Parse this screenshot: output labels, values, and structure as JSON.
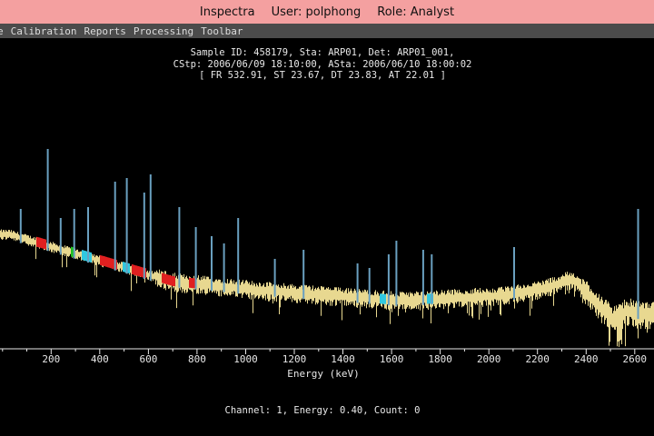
{
  "window": {
    "app_name": "Inspectra",
    "user": "User: polphong",
    "role": "Role: Analyst"
  },
  "menu": {
    "items": [
      "e",
      "Calibration",
      "Reports",
      "Processing",
      "Toolbar"
    ]
  },
  "plot": {
    "header_line1": "Sample ID: 458179, Sta: ARP01, Det: ARP01_001,",
    "header_line2": "CStp: 2006/06/09 18:10:00, ASta: 2006/06/10 18:00:02",
    "header_line3": "[ FR 532.91, ST 23.67, DT 23.83, AT 22.01 ]",
    "status": "Channel: 1, Energy: 0.40, Count: 0"
  },
  "chart_data": {
    "type": "line",
    "xlabel": "Energy (keV)",
    "ylabel": "",
    "xlim": [
      0,
      2700
    ],
    "x_ticks": [
      200,
      400,
      600,
      800,
      1000,
      1200,
      1400,
      1600,
      1800,
      2000,
      2200,
      2400,
      2600
    ],
    "colors": {
      "spectrum": "#e8d890",
      "peak": "#6aa0c0",
      "peak_highlight": "#30c8e0",
      "roi_red": "#e02020",
      "roi_green": "#20c020",
      "axis": "#e8e8e8"
    },
    "peaks_keV": [
      75,
      186,
      239,
      295,
      352,
      463,
      511,
      583,
      609,
      727,
      795,
      860,
      911,
      969,
      1120,
      1238,
      1460,
      1509,
      1588,
      1620,
      1730,
      1765,
      2104,
      2614
    ]
  }
}
